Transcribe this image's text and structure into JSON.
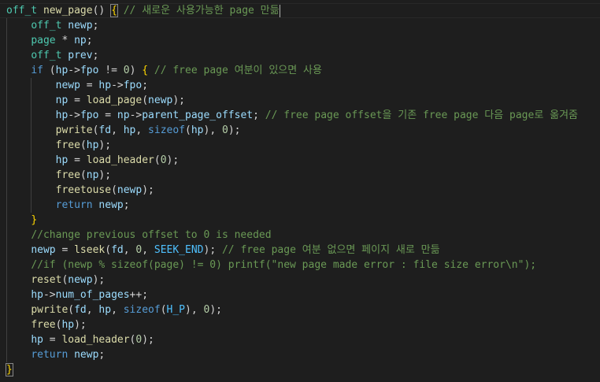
{
  "colors": {
    "background": "#1e1e1e",
    "keyword": "#569cd6",
    "type": "#4ec9b0",
    "function": "#dcdcaa",
    "variable": "#9cdcfe",
    "number": "#b5cea8",
    "comment": "#6a9955",
    "macro": "#4fc1ff",
    "bracket": "#ffd700"
  },
  "code": {
    "lines": [
      [
        [
          "ty",
          "off_t"
        ],
        [
          "op",
          " "
        ],
        [
          "fn",
          "new_page"
        ],
        [
          "op",
          "() "
        ],
        [
          "brm",
          "{"
        ],
        [
          "op",
          " "
        ],
        [
          "cm",
          "// 새로운 사용가능한 page 만듦"
        ],
        [
          "cursor",
          ""
        ]
      ],
      [
        [
          "op",
          "    "
        ],
        [
          "ty",
          "off_t"
        ],
        [
          "op",
          " "
        ],
        [
          "va",
          "newp"
        ],
        [
          "op",
          ";"
        ]
      ],
      [
        [
          "op",
          "    "
        ],
        [
          "ty",
          "page"
        ],
        [
          "op",
          " * "
        ],
        [
          "va",
          "np"
        ],
        [
          "op",
          ";"
        ]
      ],
      [
        [
          "op",
          "    "
        ],
        [
          "ty",
          "off_t"
        ],
        [
          "op",
          " "
        ],
        [
          "va",
          "prev"
        ],
        [
          "op",
          ";"
        ]
      ],
      [
        [
          "op",
          "    "
        ],
        [
          "kw",
          "if"
        ],
        [
          "op",
          " ("
        ],
        [
          "va",
          "hp"
        ],
        [
          "op",
          "->"
        ],
        [
          "va",
          "fpo"
        ],
        [
          "op",
          " != "
        ],
        [
          "nu",
          "0"
        ],
        [
          "op",
          ") "
        ],
        [
          "br",
          "{"
        ],
        [
          "op",
          " "
        ],
        [
          "cm",
          "// free page 여분이 있으면 사용"
        ]
      ],
      [
        [
          "op",
          "        "
        ],
        [
          "va",
          "newp"
        ],
        [
          "op",
          " = "
        ],
        [
          "va",
          "hp"
        ],
        [
          "op",
          "->"
        ],
        [
          "va",
          "fpo"
        ],
        [
          "op",
          ";"
        ]
      ],
      [
        [
          "op",
          "        "
        ],
        [
          "va",
          "np"
        ],
        [
          "op",
          " = "
        ],
        [
          "fn",
          "load_page"
        ],
        [
          "op",
          "("
        ],
        [
          "va",
          "newp"
        ],
        [
          "op",
          ");"
        ]
      ],
      [
        [
          "op",
          "        "
        ],
        [
          "va",
          "hp"
        ],
        [
          "op",
          "->"
        ],
        [
          "va",
          "fpo"
        ],
        [
          "op",
          " = "
        ],
        [
          "va",
          "np"
        ],
        [
          "op",
          "->"
        ],
        [
          "va",
          "parent_page_offset"
        ],
        [
          "op",
          "; "
        ],
        [
          "cm",
          "// free page offset을 기존 free page 다음 page로 옮겨줌"
        ]
      ],
      [
        [
          "op",
          "        "
        ],
        [
          "fn",
          "pwrite"
        ],
        [
          "op",
          "("
        ],
        [
          "va",
          "fd"
        ],
        [
          "op",
          ", "
        ],
        [
          "va",
          "hp"
        ],
        [
          "op",
          ", "
        ],
        [
          "kw",
          "sizeof"
        ],
        [
          "op",
          "("
        ],
        [
          "va",
          "hp"
        ],
        [
          "op",
          "), "
        ],
        [
          "nu",
          "0"
        ],
        [
          "op",
          ");"
        ]
      ],
      [
        [
          "op",
          "        "
        ],
        [
          "fn",
          "free"
        ],
        [
          "op",
          "("
        ],
        [
          "va",
          "hp"
        ],
        [
          "op",
          ");"
        ]
      ],
      [
        [
          "op",
          "        "
        ],
        [
          "va",
          "hp"
        ],
        [
          "op",
          " = "
        ],
        [
          "fn",
          "load_header"
        ],
        [
          "op",
          "("
        ],
        [
          "nu",
          "0"
        ],
        [
          "op",
          ");"
        ]
      ],
      [
        [
          "op",
          "        "
        ],
        [
          "fn",
          "free"
        ],
        [
          "op",
          "("
        ],
        [
          "va",
          "np"
        ],
        [
          "op",
          ");"
        ]
      ],
      [
        [
          "op",
          "        "
        ],
        [
          "fn",
          "freetouse"
        ],
        [
          "op",
          "("
        ],
        [
          "va",
          "newp"
        ],
        [
          "op",
          ");"
        ]
      ],
      [
        [
          "op",
          "        "
        ],
        [
          "kw",
          "return"
        ],
        [
          "op",
          " "
        ],
        [
          "va",
          "newp"
        ],
        [
          "op",
          ";"
        ]
      ],
      [
        [
          "op",
          "    "
        ],
        [
          "br",
          "}"
        ]
      ],
      [
        [
          "op",
          "    "
        ],
        [
          "cm",
          "//change previous offset to 0 is needed"
        ]
      ],
      [
        [
          "op",
          "    "
        ],
        [
          "va",
          "newp"
        ],
        [
          "op",
          " = "
        ],
        [
          "fn",
          "lseek"
        ],
        [
          "op",
          "("
        ],
        [
          "va",
          "fd"
        ],
        [
          "op",
          ", "
        ],
        [
          "nu",
          "0"
        ],
        [
          "op",
          ", "
        ],
        [
          "ma",
          "SEEK_END"
        ],
        [
          "op",
          "); "
        ],
        [
          "cm",
          "// free page 여분 없으면 페이지 새로 만듦"
        ]
      ],
      [
        [
          "op",
          "    "
        ],
        [
          "cm",
          "//if (newp % sizeof(page) != 0) printf(\"new page made error : file size error\\n\");"
        ]
      ],
      [
        [
          "op",
          "    "
        ],
        [
          "fn",
          "reset"
        ],
        [
          "op",
          "("
        ],
        [
          "va",
          "newp"
        ],
        [
          "op",
          ");"
        ]
      ],
      [
        [
          "op",
          "    "
        ],
        [
          "va",
          "hp"
        ],
        [
          "op",
          "->"
        ],
        [
          "va",
          "num_of_pages"
        ],
        [
          "op",
          "++;"
        ]
      ],
      [
        [
          "op",
          "    "
        ],
        [
          "fn",
          "pwrite"
        ],
        [
          "op",
          "("
        ],
        [
          "va",
          "fd"
        ],
        [
          "op",
          ", "
        ],
        [
          "va",
          "hp"
        ],
        [
          "op",
          ", "
        ],
        [
          "kw",
          "sizeof"
        ],
        [
          "op",
          "("
        ],
        [
          "ma",
          "H_P"
        ],
        [
          "op",
          "), "
        ],
        [
          "nu",
          "0"
        ],
        [
          "op",
          ");"
        ]
      ],
      [
        [
          "op",
          "    "
        ],
        [
          "fn",
          "free"
        ],
        [
          "op",
          "("
        ],
        [
          "va",
          "hp"
        ],
        [
          "op",
          ");"
        ]
      ],
      [
        [
          "op",
          "    "
        ],
        [
          "va",
          "hp"
        ],
        [
          "op",
          " = "
        ],
        [
          "fn",
          "load_header"
        ],
        [
          "op",
          "("
        ],
        [
          "nu",
          "0"
        ],
        [
          "op",
          ");"
        ]
      ],
      [
        [
          "op",
          "    "
        ],
        [
          "kw",
          "return"
        ],
        [
          "op",
          " "
        ],
        [
          "va",
          "newp"
        ],
        [
          "op",
          ";"
        ]
      ],
      [
        [
          "brm",
          "}"
        ]
      ]
    ]
  }
}
